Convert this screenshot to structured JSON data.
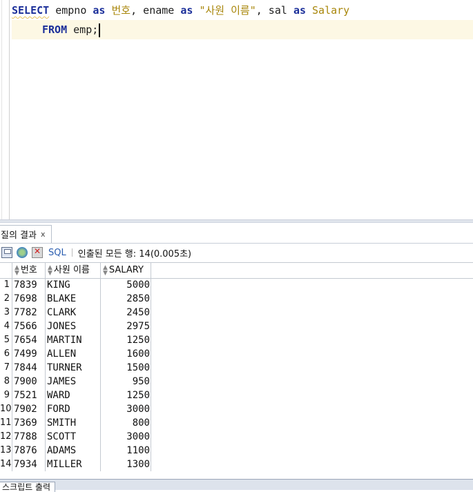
{
  "editor": {
    "line1": {
      "kw_select": "SELECT",
      "col1": " empno ",
      "as1": "as",
      "alias1": " 번호",
      "comma1": ", ename ",
      "as2": "as",
      "alias2": " \"사원 이름\"",
      "comma2": ", sal ",
      "as3": "as",
      "alias3": " Salary"
    },
    "line2": {
      "kw_from": "FROM",
      "table": " emp;"
    }
  },
  "result_tab": {
    "label": "질의 결과",
    "close": "x"
  },
  "toolbar": {
    "sql_label": "SQL",
    "status": "인출된 모든 행: 14(0.005초)"
  },
  "grid": {
    "columns": [
      "번호",
      "사원 이름",
      "SALARY"
    ],
    "rows": [
      {
        "n": "1",
        "empno": "7839",
        "ename": "KING",
        "sal": "5000"
      },
      {
        "n": "2",
        "empno": "7698",
        "ename": "BLAKE",
        "sal": "2850"
      },
      {
        "n": "3",
        "empno": "7782",
        "ename": "CLARK",
        "sal": "2450"
      },
      {
        "n": "4",
        "empno": "7566",
        "ename": "JONES",
        "sal": "2975"
      },
      {
        "n": "5",
        "empno": "7654",
        "ename": "MARTIN",
        "sal": "1250"
      },
      {
        "n": "6",
        "empno": "7499",
        "ename": "ALLEN",
        "sal": "1600"
      },
      {
        "n": "7",
        "empno": "7844",
        "ename": "TURNER",
        "sal": "1500"
      },
      {
        "n": "8",
        "empno": "7900",
        "ename": "JAMES",
        "sal": "950"
      },
      {
        "n": "9",
        "empno": "7521",
        "ename": "WARD",
        "sal": "1250"
      },
      {
        "n": "10",
        "empno": "7902",
        "ename": "FORD",
        "sal": "3000"
      },
      {
        "n": "11",
        "empno": "7369",
        "ename": "SMITH",
        "sal": "800"
      },
      {
        "n": "12",
        "empno": "7788",
        "ename": "SCOTT",
        "sal": "3000"
      },
      {
        "n": "13",
        "empno": "7876",
        "ename": "ADAMS",
        "sal": "1100"
      },
      {
        "n": "14",
        "empno": "7934",
        "ename": "MILLER",
        "sal": "1300"
      }
    ]
  },
  "bottom_tab": {
    "label": "스크립트 출력"
  }
}
